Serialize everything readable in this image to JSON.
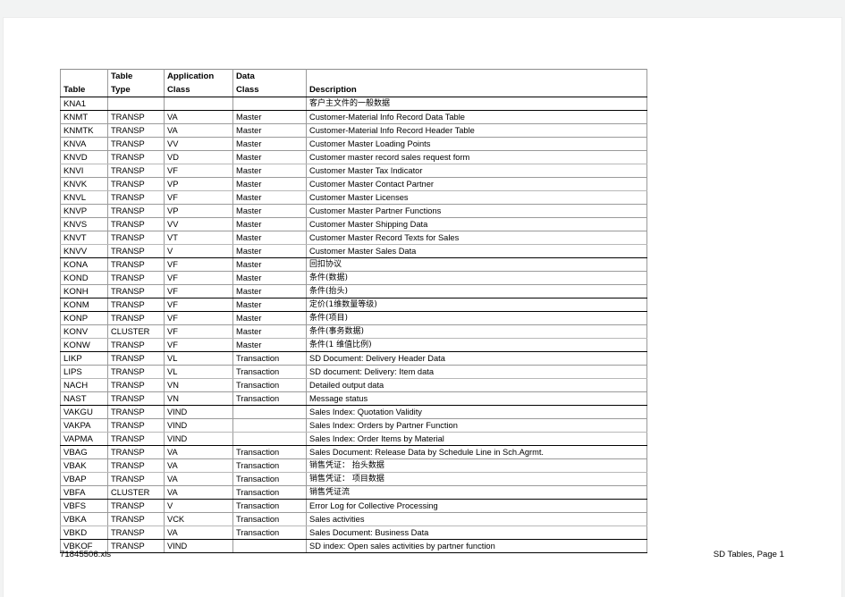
{
  "document": {
    "footer_left": "71845506.xls",
    "footer_right": "SD Tables, Page 1"
  },
  "table": {
    "headers_line1": [
      "",
      "Table",
      "Application",
      "Data",
      ""
    ],
    "headers_line2": [
      "Table",
      "Type",
      "Class",
      "Class",
      "Description"
    ],
    "rows": [
      {
        "table": "KNA1",
        "type": "",
        "app": "",
        "data": "",
        "desc": "客户主文件的一般数据",
        "cjk": true,
        "rule": "thick"
      },
      {
        "table": "KNMT",
        "type": "TRANSP",
        "app": "VA",
        "data": "Master",
        "desc": "Customer-Material Info Record Data Table",
        "cjk": false,
        "rule": "normal"
      },
      {
        "table": "KNMTK",
        "type": "TRANSP",
        "app": "VA",
        "data": "Master",
        "desc": "Customer-Material Info Record Header Table",
        "cjk": false,
        "rule": "normal"
      },
      {
        "table": "KNVA",
        "type": "TRANSP",
        "app": "VV",
        "data": "Master",
        "desc": "Customer Master Loading Points",
        "cjk": false,
        "rule": "normal"
      },
      {
        "table": "KNVD",
        "type": "TRANSP",
        "app": "VD",
        "data": "Master",
        "desc": "Customer master record sales request form",
        "cjk": false,
        "rule": "light"
      },
      {
        "table": "KNVI",
        "type": "TRANSP",
        "app": "VF",
        "data": "Master",
        "desc": "Customer Master Tax Indicator",
        "cjk": false,
        "rule": "normal"
      },
      {
        "table": "KNVK",
        "type": "TRANSP",
        "app": "VP",
        "data": "Master",
        "desc": "Customer Master Contact Partner",
        "cjk": false,
        "rule": "light"
      },
      {
        "table": "KNVL",
        "type": "TRANSP",
        "app": "VF",
        "data": "Master",
        "desc": "Customer Master Licenses",
        "cjk": false,
        "rule": "normal"
      },
      {
        "table": "KNVP",
        "type": "TRANSP",
        "app": "VP",
        "data": "Master",
        "desc": "Customer Master Partner Functions",
        "cjk": false,
        "rule": "normal"
      },
      {
        "table": "KNVS",
        "type": "TRANSP",
        "app": "VV",
        "data": "Master",
        "desc": "Customer Master Shipping Data",
        "cjk": false,
        "rule": "normal"
      },
      {
        "table": "KNVT",
        "type": "TRANSP",
        "app": "VT",
        "data": "Master",
        "desc": "Customer Master Record Texts for Sales",
        "cjk": false,
        "rule": "light"
      },
      {
        "table": "KNVV",
        "type": "TRANSP",
        "app": "V",
        "data": "Master",
        "desc": "Customer Master Sales Data",
        "cjk": false,
        "rule": "thick"
      },
      {
        "table": "KONA",
        "type": "TRANSP",
        "app": "VF",
        "data": "Master",
        "desc": "回扣协议",
        "cjk": true,
        "rule": "normal"
      },
      {
        "table": "KOND",
        "type": "TRANSP",
        "app": "VF",
        "data": "Master",
        "desc": "条件(数据)",
        "cjk": true,
        "rule": "normal"
      },
      {
        "table": "KONH",
        "type": "TRANSP",
        "app": "VF",
        "data": "Master",
        "desc": "条件(抬头)",
        "cjk": true,
        "rule": "thick"
      },
      {
        "table": "KONM",
        "type": "TRANSP",
        "app": "VF",
        "data": "Master",
        "desc": "定价(1维数量等级)",
        "cjk": true,
        "rule": "thick"
      },
      {
        "table": "KONP",
        "type": "TRANSP",
        "app": "VF",
        "data": "Master",
        "desc": "条件(项目)",
        "cjk": true,
        "rule": "normal"
      },
      {
        "table": "KONV",
        "type": "CLUSTER",
        "app": "VF",
        "data": "Master",
        "desc": "条件(事务数据)",
        "cjk": true,
        "rule": "light"
      },
      {
        "table": "KONW",
        "type": "TRANSP",
        "app": "VF",
        "data": "Master",
        "desc": "条件(1 维值比例)",
        "cjk": true,
        "rule": "thick"
      },
      {
        "table": "LIKP",
        "type": "TRANSP",
        "app": "VL",
        "data": "Transaction",
        "desc": "SD Document: Delivery Header Data",
        "cjk": false,
        "rule": "normal"
      },
      {
        "table": "LIPS",
        "type": "TRANSP",
        "app": "VL",
        "data": "Transaction",
        "desc": "SD document: Delivery: Item data",
        "cjk": false,
        "rule": "light"
      },
      {
        "table": "NACH",
        "type": "TRANSP",
        "app": "VN",
        "data": "Transaction",
        "desc": "Detailed output data",
        "cjk": false,
        "rule": "normal"
      },
      {
        "table": "NAST",
        "type": "TRANSP",
        "app": "VN",
        "data": "Transaction",
        "desc": "Message status",
        "cjk": false,
        "rule": "thick"
      },
      {
        "table": "VAKGU",
        "type": "TRANSP",
        "app": "VIND",
        "data": "",
        "desc": "Sales Index: Quotation Validity",
        "cjk": false,
        "rule": "normal"
      },
      {
        "table": "VAKPA",
        "type": "TRANSP",
        "app": "VIND",
        "data": "",
        "desc": "Sales Index: Orders by Partner Function",
        "cjk": false,
        "rule": "light"
      },
      {
        "table": "VAPMA",
        "type": "TRANSP",
        "app": "VIND",
        "data": "",
        "desc": "Sales Index: Order Items by Material",
        "cjk": false,
        "rule": "thick"
      },
      {
        "table": "VBAG",
        "type": "TRANSP",
        "app": "VA",
        "data": "Transaction",
        "desc": "Sales Document: Release Data by Schedule Line in Sch.Agrmt.",
        "cjk": false,
        "rule": "normal"
      },
      {
        "table": "VBAK",
        "type": "TRANSP",
        "app": "VA",
        "data": "Transaction",
        "desc": "销售凭证： 抬头数据",
        "cjk": true,
        "rule": "light"
      },
      {
        "table": "VBAP",
        "type": "TRANSP",
        "app": "VA",
        "data": "Transaction",
        "desc": "销售凭证： 项目数据",
        "cjk": true,
        "rule": "normal"
      },
      {
        "table": "VBFA",
        "type": "CLUSTER",
        "app": "VA",
        "data": "Transaction",
        "desc": "销售凭证流",
        "cjk": true,
        "rule": "thick"
      },
      {
        "table": "VBFS",
        "type": "TRANSP",
        "app": "V",
        "data": "Transaction",
        "desc": "Error Log for Collective Processing",
        "cjk": false,
        "rule": "normal"
      },
      {
        "table": "VBKA",
        "type": "TRANSP",
        "app": "VCK",
        "data": "Transaction",
        "desc": "Sales activities",
        "cjk": false,
        "rule": "light"
      },
      {
        "table": "VBKD",
        "type": "TRANSP",
        "app": "VA",
        "data": "Transaction",
        "desc": "Sales Document: Business Data",
        "cjk": false,
        "rule": "thick"
      },
      {
        "table": "VBKOF",
        "type": "TRANSP",
        "app": "VIND",
        "data": "",
        "desc": "SD index: Open sales activities by partner function",
        "cjk": false,
        "rule": "thick"
      }
    ]
  }
}
